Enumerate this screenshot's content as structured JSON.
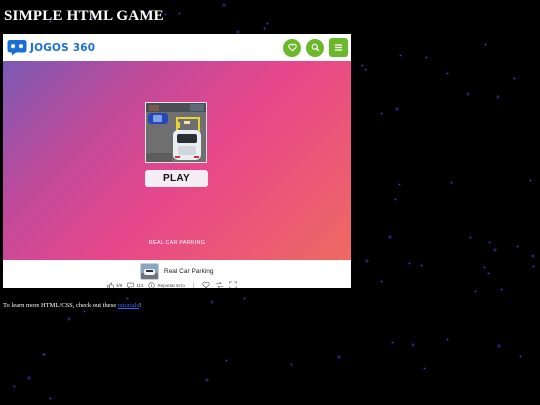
{
  "page": {
    "title": "SIMPLE HTML GAME"
  },
  "header": {
    "logo_text": "JOGOS 360"
  },
  "game": {
    "play_label": "PLAY",
    "caption": "REAL CAR PARKING",
    "name": "Real Car Parking",
    "likes": "3/9",
    "comments": "113",
    "report_label": "Reportar Erro"
  },
  "footer": {
    "text_before": "To learn more HTML/CSS, check out these ",
    "link_text": "tutorials",
    "text_after": "!"
  },
  "colors": {
    "background": "#000000",
    "star": "#3b46c7",
    "brand_blue": "#1a6fd6",
    "button_green": "#6cb82c",
    "stage_gradient_start": "#7a5ab4",
    "stage_gradient_end": "#ef6a60"
  },
  "icons": {
    "heart": "heart-icon",
    "search": "search-icon",
    "menu": "hamburger-menu-icon",
    "logo": "gamepad-chat-icon",
    "like": "thumbs-up-icon",
    "comment": "comment-icon",
    "report": "info-circle-icon",
    "favorite": "heart-outline-icon",
    "share": "share-icon",
    "fullscreen": "fullscreen-icon"
  }
}
